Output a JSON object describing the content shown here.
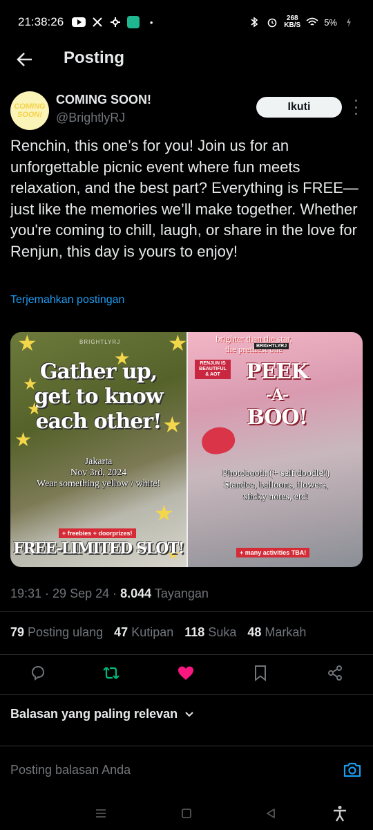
{
  "status_bar": {
    "time": "21:38:26",
    "data_speed_top": "268",
    "data_speed_bottom": "KB/S",
    "battery": "5%"
  },
  "header": {
    "title": "Posting"
  },
  "author": {
    "display_name": "COMING SOON!",
    "handle": "@BrightlyRJ",
    "avatar_text": "COMING SOON!",
    "follow_label": "Ikuti"
  },
  "tweet": {
    "text": "Renchin, this one’s for you! Join us for an unforgettable picnic event where fun meets relaxation, and the best part? Everything is FREE—just like the memories we’ll make together. Whether you're coming to chill, laugh, or share in the love for Renjun, this day is yours to enjoy!",
    "translate_link": "Terjemahkan postingan"
  },
  "media": {
    "left": {
      "watermark": "BRIGHTLYRJ",
      "headline_1": "Gather up,",
      "headline_2": "get to know",
      "headline_3": "each other!",
      "location": "Jakarta",
      "date": "Nov 3rd, 2024",
      "dress_code": "Wear something yellow / white!",
      "badge": "+ freebies + doorprizes!",
      "footer": "FREE-LIMITED SLOT!"
    },
    "right": {
      "tagline_1": "brighter than the star,",
      "tagline_2": "the prettiest one",
      "watermark": "BRIGHTLYRJ",
      "sticker": "RENJUN IS BEAUTIFUL & AOT",
      "headline_1": "PEEK",
      "headline_2": "-A-",
      "headline_3": "BOO!",
      "desc_1": "Photobooth (+ self doodle!)",
      "desc_2": "Standee, balloons, flowers,",
      "desc_3": "sticky notes, etc!",
      "badge": "+ many activities TBA!"
    }
  },
  "meta": {
    "time": "19:31",
    "date": "29 Sep 24",
    "views": "8.044",
    "views_label": "Tayangan"
  },
  "stats": {
    "reposts": "79",
    "reposts_label": "Posting ulang",
    "quotes": "47",
    "quotes_label": "Kutipan",
    "likes": "118",
    "likes_label": "Suka",
    "bookmarks": "48",
    "bookmarks_label": "Markah"
  },
  "replies": {
    "sort_label": "Balasan yang paling relevan",
    "input_placeholder": "Posting balasan Anda"
  },
  "colors": {
    "accent": "#1d9bf0",
    "repost": "#00ba7c",
    "like": "#f91880",
    "muted": "#71767b"
  }
}
